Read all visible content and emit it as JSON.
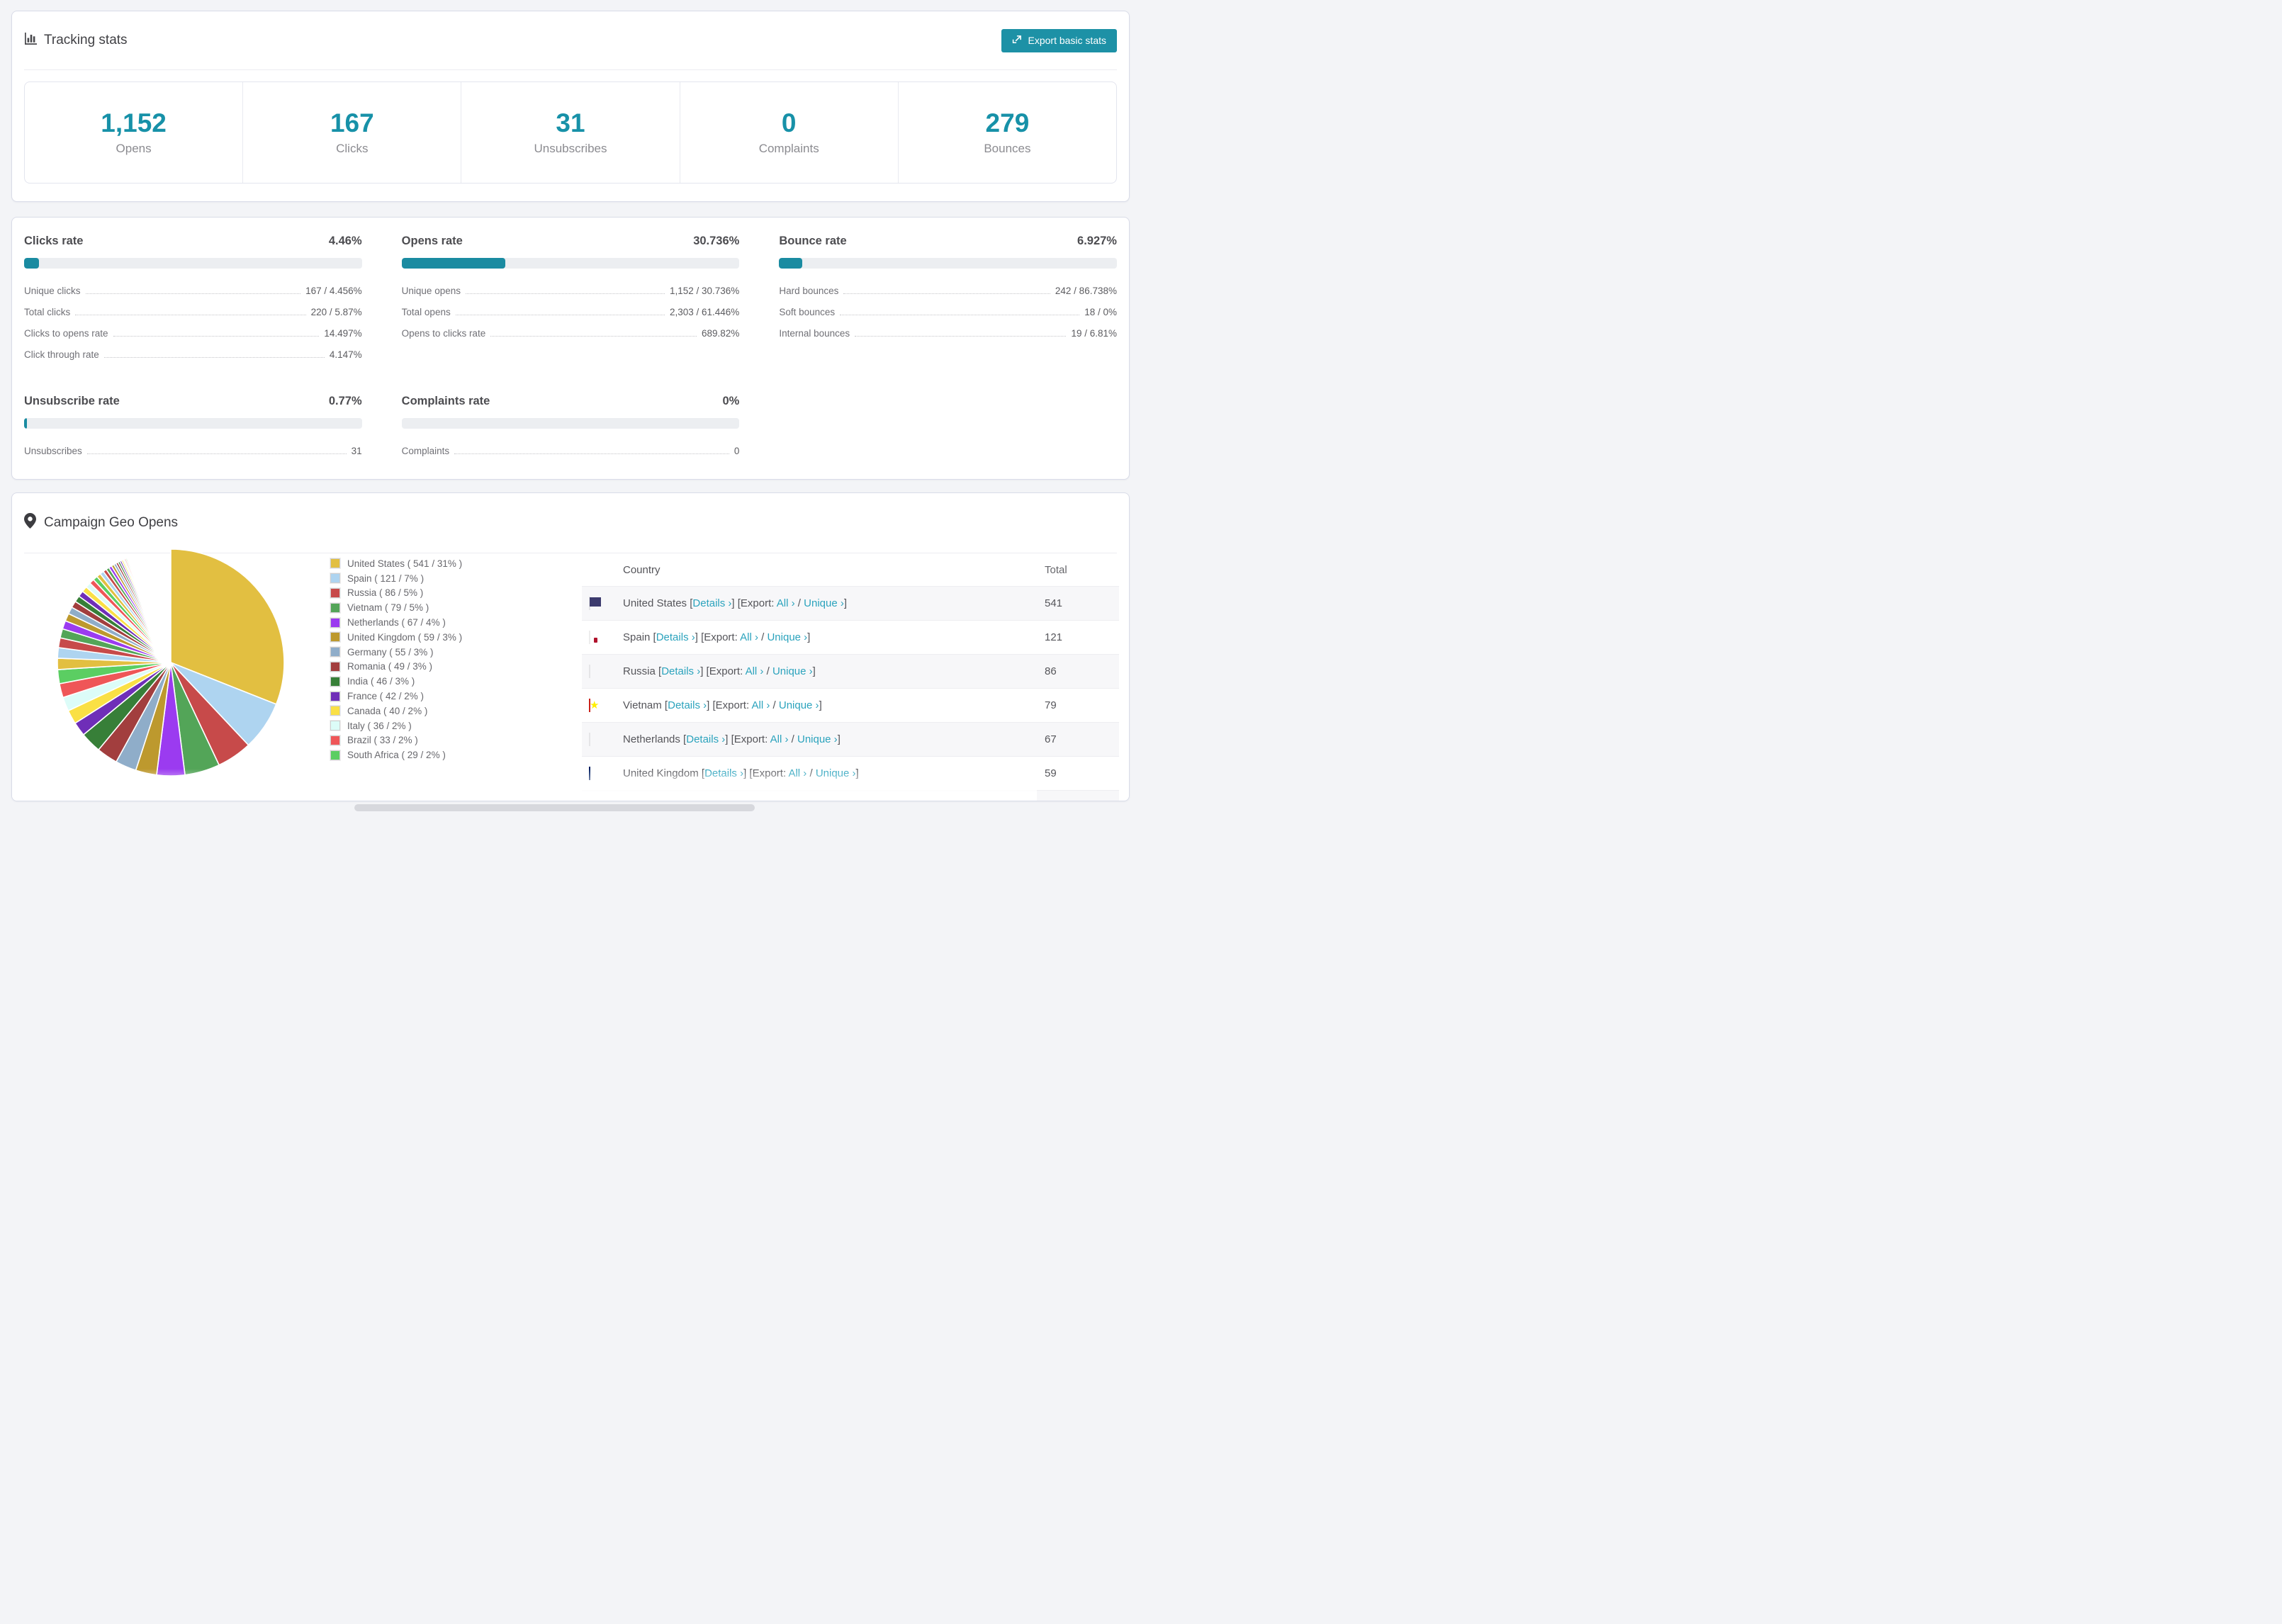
{
  "tracking": {
    "title": "Tracking stats",
    "export_label": "Export basic stats",
    "summary": [
      {
        "value": "1,152",
        "label": "Opens"
      },
      {
        "value": "167",
        "label": "Clicks"
      },
      {
        "value": "31",
        "label": "Unsubscribes"
      },
      {
        "value": "0",
        "label": "Complaints"
      },
      {
        "value": "279",
        "label": "Bounces"
      }
    ]
  },
  "rates": {
    "accent_color": "#1791a8",
    "sections": [
      {
        "title": "Clicks rate",
        "value": "4.46%",
        "bar_pct": 4.46,
        "rows": [
          {
            "label": "Unique clicks",
            "value": "167 / 4.456%"
          },
          {
            "label": "Total clicks",
            "value": "220 / 5.87%"
          },
          {
            "label": "Clicks to opens rate",
            "value": "14.497%"
          },
          {
            "label": "Click through rate",
            "value": "4.147%"
          }
        ]
      },
      {
        "title": "Opens rate",
        "value": "30.736%",
        "bar_pct": 30.736,
        "rows": [
          {
            "label": "Unique opens",
            "value": "1,152 / 30.736%"
          },
          {
            "label": "Total opens",
            "value": "2,303 / 61.446%"
          },
          {
            "label": "Opens to clicks rate",
            "value": "689.82%"
          }
        ]
      },
      {
        "title": "Bounce rate",
        "value": "6.927%",
        "bar_pct": 6.927,
        "rows": [
          {
            "label": "Hard bounces",
            "value": "242 / 86.738%"
          },
          {
            "label": "Soft bounces",
            "value": "18 / 0%"
          },
          {
            "label": "Internal bounces",
            "value": "19 / 6.81%"
          }
        ]
      },
      {
        "title": "Unsubscribe rate",
        "value": "0.77%",
        "bar_pct": 0.77,
        "rows": [
          {
            "label": "Unsubscribes",
            "value": "31"
          }
        ]
      },
      {
        "title": "Complaints rate",
        "value": "0%",
        "bar_pct": 0,
        "rows": [
          {
            "label": "Complaints",
            "value": "0"
          }
        ]
      }
    ]
  },
  "geo": {
    "title": "Campaign Geo Opens",
    "table": {
      "header_country": "Country",
      "header_total": "Total",
      "link_details": "Details",
      "link_export_prefix": "Export:",
      "link_all": "All",
      "link_unique": "Unique",
      "chevron": "›",
      "rows": [
        {
          "flag": "us",
          "country": "United States",
          "total": "541"
        },
        {
          "flag": "es",
          "country": "Spain",
          "total": "121"
        },
        {
          "flag": "ru",
          "country": "Russia",
          "total": "86"
        },
        {
          "flag": "vn",
          "country": "Vietnam",
          "total": "79"
        },
        {
          "flag": "nl",
          "country": "Netherlands",
          "total": "67"
        },
        {
          "flag": "gb",
          "country": "United Kingdom",
          "total": "59"
        }
      ],
      "partial_row": {
        "flag": "de"
      }
    }
  },
  "chart_data": {
    "type": "pie",
    "title": "Campaign Geo Opens",
    "legend_position": "right",
    "start_angle_deg": 0,
    "series": [
      {
        "name": "United States",
        "value": 541,
        "pct": 31
      },
      {
        "name": "Spain",
        "value": 121,
        "pct": 7
      },
      {
        "name": "Russia",
        "value": 86,
        "pct": 5
      },
      {
        "name": "Vietnam",
        "value": 79,
        "pct": 5
      },
      {
        "name": "Netherlands",
        "value": 67,
        "pct": 4
      },
      {
        "name": "United Kingdom",
        "value": 59,
        "pct": 3
      },
      {
        "name": "Germany",
        "value": 55,
        "pct": 3
      },
      {
        "name": "Romania",
        "value": 49,
        "pct": 3
      },
      {
        "name": "India",
        "value": 46,
        "pct": 3
      },
      {
        "name": "France",
        "value": 42,
        "pct": 2
      },
      {
        "name": "Canada",
        "value": 40,
        "pct": 2
      },
      {
        "name": "Italy",
        "value": 36,
        "pct": 2
      },
      {
        "name": "Brazil",
        "value": 33,
        "pct": 2
      },
      {
        "name": "South Africa",
        "value": 29,
        "pct": 2
      }
    ],
    "other_slices_pct": [
      1.6,
      1.5,
      1.4,
      1.3,
      1.2,
      1.1,
      1.0,
      0.95,
      0.9,
      0.85,
      0.8,
      0.75,
      0.7,
      0.65,
      0.6,
      0.55,
      0.5,
      0.46,
      0.42,
      0.38,
      0.35,
      0.32,
      0.29,
      0.26,
      0.24,
      0.22,
      0.2,
      0.18,
      0.16,
      0.14,
      0.13,
      0.12,
      0.11,
      0.1,
      0.09,
      0.08,
      0.07,
      0.06,
      0.05,
      0.05,
      0.04,
      0.04,
      0.03,
      0.03,
      0.02,
      0.02,
      0.02,
      0.01,
      0.01,
      0.01
    ],
    "palette": [
      "#e2bf41",
      "#aed4f0",
      "#c74a4a",
      "#53a558",
      "#9b3bf0",
      "#bd992e",
      "#8fadc9",
      "#a23e3e",
      "#377f38",
      "#6f2eb8",
      "#fae045",
      "#dcfcf8",
      "#ef5658",
      "#5bce62"
    ]
  }
}
